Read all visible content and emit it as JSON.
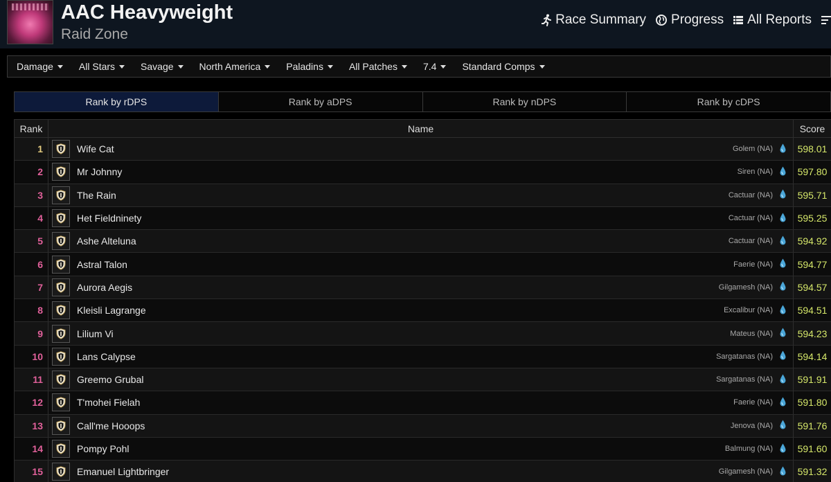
{
  "header": {
    "title": "AAC Heavyweight",
    "subtitle": "Raid Zone",
    "nav": {
      "race_summary": "Race Summary",
      "progress": "Progress",
      "all_reports": "All Reports"
    }
  },
  "filters": [
    "Damage",
    "All Stars",
    "Savage",
    "North America",
    "Paladins",
    "All Patches",
    "7.4",
    "Standard Comps"
  ],
  "tabs": [
    "Rank by rDPS",
    "Rank by aDPS",
    "Rank by nDPS",
    "Rank by cDPS"
  ],
  "active_tab": "Rank by rDPS",
  "table": {
    "headers": {
      "rank": "Rank",
      "name": "Name",
      "score": "Score"
    },
    "rows": [
      {
        "rank": "1",
        "name": "Wife Cat",
        "server": "Golem (NA)",
        "score": "598.01"
      },
      {
        "rank": "2",
        "name": "Mr Johnny",
        "server": "Siren (NA)",
        "score": "597.80"
      },
      {
        "rank": "3",
        "name": "The Rain",
        "server": "Cactuar (NA)",
        "score": "595.71"
      },
      {
        "rank": "4",
        "name": "Het Fieldninety",
        "server": "Cactuar (NA)",
        "score": "595.25"
      },
      {
        "rank": "5",
        "name": "Ashe Alteluna",
        "server": "Cactuar (NA)",
        "score": "594.92"
      },
      {
        "rank": "6",
        "name": "Astral Talon",
        "server": "Faerie (NA)",
        "score": "594.77"
      },
      {
        "rank": "7",
        "name": "Aurora Aegis",
        "server": "Gilgamesh (NA)",
        "score": "594.57"
      },
      {
        "rank": "8",
        "name": "Kleisli Lagrange",
        "server": "Excalibur (NA)",
        "score": "594.51"
      },
      {
        "rank": "9",
        "name": "Lilium Vi",
        "server": "Mateus (NA)",
        "score": "594.23"
      },
      {
        "rank": "10",
        "name": "Lans Calypse",
        "server": "Sargatanas (NA)",
        "score": "594.14"
      },
      {
        "rank": "11",
        "name": "Greemo Grubal",
        "server": "Sargatanas (NA)",
        "score": "591.91"
      },
      {
        "rank": "12",
        "name": "T'mohei Fielah",
        "server": "Faerie (NA)",
        "score": "591.80"
      },
      {
        "rank": "13",
        "name": "Call'me Hooops",
        "server": "Jenova (NA)",
        "score": "591.76"
      },
      {
        "rank": "14",
        "name": "Pompy Pohl",
        "server": "Balmung (NA)",
        "score": "591.60"
      },
      {
        "rank": "15",
        "name": "Emanuel Lightbringer",
        "server": "Gilgamesh (NA)",
        "score": "591.32"
      }
    ]
  },
  "icons": {
    "job": "paladin-shield-icon",
    "server": "aether-drop-icon"
  },
  "colors": {
    "rank_first": "#e5cc80",
    "rank_other": "#e0609a",
    "score": "#d6e86a",
    "active_tab": "#0d1a3a"
  }
}
